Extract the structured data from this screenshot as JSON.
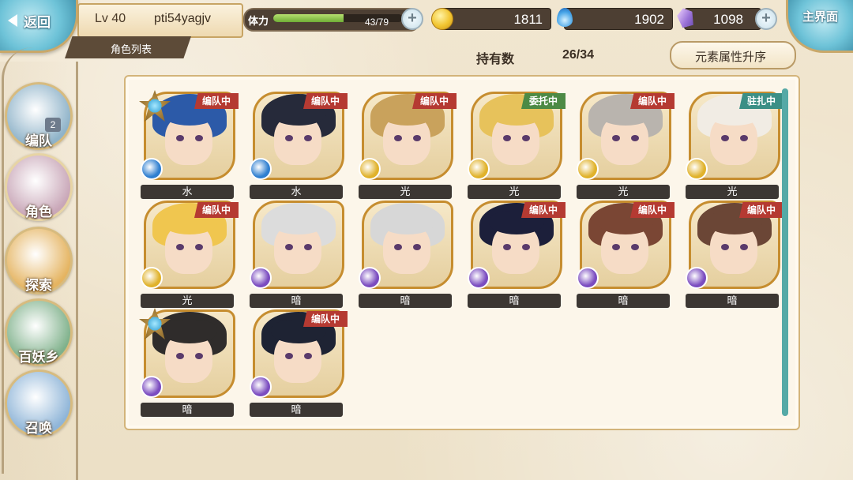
{
  "header": {
    "back_label": "返回",
    "level": "Lv 40",
    "player_name": "pti54yagjv",
    "role_list_label": "角色列表",
    "main_screen_label": "主界面",
    "stamina": {
      "label": "体力",
      "text": "43/79",
      "fraction": 0.544
    },
    "gold": "1811",
    "soul_fire": "1902",
    "crystal": "1098"
  },
  "summary": {
    "owned_label": "持有数",
    "owned_count": "26/34",
    "sort_label": "元素属性升序"
  },
  "nav": [
    {
      "label": "编队",
      "badge": "2",
      "color": "#8fb3c9"
    },
    {
      "label": "角色",
      "badge": "",
      "color": "#c9a7b8"
    },
    {
      "label": "探索",
      "badge": "",
      "color": "#e5b461"
    },
    {
      "label": "百妖乡",
      "badge": "",
      "color": "#7fb18b"
    },
    {
      "label": "召唤",
      "badge": "",
      "color": "#8fb5d8"
    }
  ],
  "characters": [
    {
      "element": "水",
      "status": "编队中",
      "status_type": "team",
      "star": true,
      "hair": "#2c5aa8",
      "badge": "#2f7fd0"
    },
    {
      "element": "水",
      "status": "编队中",
      "status_type": "team",
      "star": false,
      "hair": "#262a3a",
      "badge": "#2f7fd0"
    },
    {
      "element": "光",
      "status": "编队中",
      "status_type": "team",
      "star": false,
      "hair": "#c9a25c",
      "badge": "#e0b22b"
    },
    {
      "element": "光",
      "status": "委托中",
      "status_type": "commission",
      "star": false,
      "hair": "#e7c25b",
      "badge": "#e0b22b"
    },
    {
      "element": "光",
      "status": "编队中",
      "status_type": "team",
      "star": false,
      "hair": "#b9b4ae",
      "badge": "#e0b22b"
    },
    {
      "element": "光",
      "status": "驻扎中",
      "status_type": "station",
      "star": false,
      "hair": "#f1ece4",
      "badge": "#e0b22b"
    },
    {
      "element": "光",
      "status": "编队中",
      "status_type": "team",
      "star": false,
      "hair": "#f0c64f",
      "badge": "#e0b22b"
    },
    {
      "element": "暗",
      "status": "",
      "status_type": "",
      "star": false,
      "hair": "#dcdcdc",
      "badge": "#7b4cc0"
    },
    {
      "element": "暗",
      "status": "",
      "status_type": "",
      "star": false,
      "hair": "#d7d7d7",
      "badge": "#7b4cc0"
    },
    {
      "element": "暗",
      "status": "编队中",
      "status_type": "team",
      "star": false,
      "hair": "#1c1f3a",
      "badge": "#7b4cc0"
    },
    {
      "element": "暗",
      "status": "编队中",
      "status_type": "team",
      "star": false,
      "hair": "#7a4634",
      "badge": "#7b4cc0"
    },
    {
      "element": "暗",
      "status": "编队中",
      "status_type": "team",
      "star": false,
      "hair": "#6b4636",
      "badge": "#7b4cc0"
    },
    {
      "element": "暗",
      "status": "",
      "status_type": "",
      "star": true,
      "hair": "#2f2c2b",
      "badge": "#7b4cc0"
    },
    {
      "element": "暗",
      "status": "编队中",
      "status_type": "team",
      "star": false,
      "hair": "#1e2333",
      "badge": "#7b4cc0"
    }
  ]
}
